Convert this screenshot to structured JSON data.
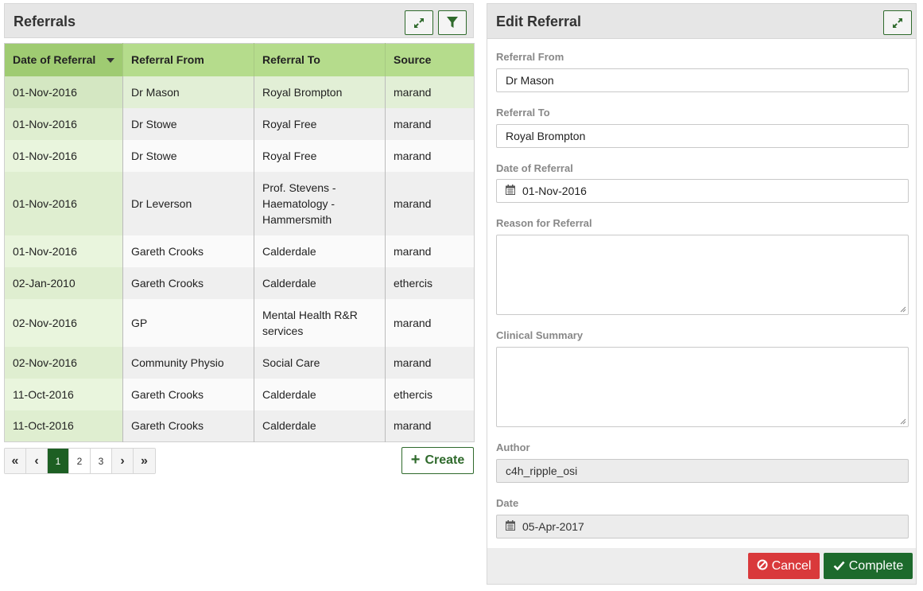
{
  "referrals": {
    "title": "Referrals",
    "columns": [
      "Date of Referral",
      "Referral From",
      "Referral To",
      "Source"
    ],
    "rows": [
      {
        "date": "01-Nov-2016",
        "from": "Dr Mason",
        "to": "Royal Brompton",
        "source": "marand"
      },
      {
        "date": "01-Nov-2016",
        "from": "Dr Stowe",
        "to": "Royal Free",
        "source": "marand"
      },
      {
        "date": "01-Nov-2016",
        "from": "Dr Stowe",
        "to": "Royal Free",
        "source": "marand"
      },
      {
        "date": "01-Nov-2016",
        "from": "Dr Leverson",
        "to_lines": [
          "Prof. Stevens -",
          "Haematology -",
          "Hammersmith"
        ],
        "source": "marand"
      },
      {
        "date": "01-Nov-2016",
        "from": "Gareth Crooks",
        "to": "Calderdale",
        "source": "marand"
      },
      {
        "date": "02-Jan-2010",
        "from": "Gareth Crooks",
        "to": "Calderdale",
        "source": "ethercis"
      },
      {
        "date": "02-Nov-2016",
        "from": "GP",
        "to_lines": [
          "Mental Health R&R",
          "services"
        ],
        "source": "marand"
      },
      {
        "date": "02-Nov-2016",
        "from": "Community Physio",
        "to": "Social Care",
        "source": "marand"
      },
      {
        "date": "11-Oct-2016",
        "from": "Gareth Crooks",
        "to": "Calderdale",
        "source": "ethercis"
      },
      {
        "date": "11-Oct-2016",
        "from": "Gareth Crooks",
        "to": "Calderdale",
        "source": "marand"
      }
    ],
    "pager": {
      "first": "«",
      "prev": "‹",
      "pages": [
        "1",
        "2",
        "3"
      ],
      "active_page": "1",
      "next": "›",
      "last": "»"
    },
    "create_label": "Create"
  },
  "edit": {
    "title": "Edit Referral",
    "fields": {
      "referral_from_label": "Referral From",
      "referral_from_value": "Dr Mason",
      "referral_to_label": "Referral To",
      "referral_to_value": "Royal Brompton",
      "date_label": "Date of Referral",
      "date_value": "01-Nov-2016",
      "reason_label": "Reason for Referral",
      "reason_value": "",
      "summary_label": "Clinical Summary",
      "summary_value": "",
      "author_label": "Author",
      "author_value": "c4h_ripple_osi",
      "created_label": "Date",
      "created_value": "05-Apr-2017"
    },
    "cancel_label": "Cancel",
    "complete_label": "Complete"
  },
  "colors": {
    "accent_green": "#1d6a2c",
    "header_green": "#b5dc8c",
    "cancel_red": "#d9393b"
  },
  "icons": [
    "expand-icon",
    "filter-icon",
    "sort-caret-icon",
    "plus-icon",
    "calendar-icon",
    "cancel-icon",
    "check-icon"
  ]
}
